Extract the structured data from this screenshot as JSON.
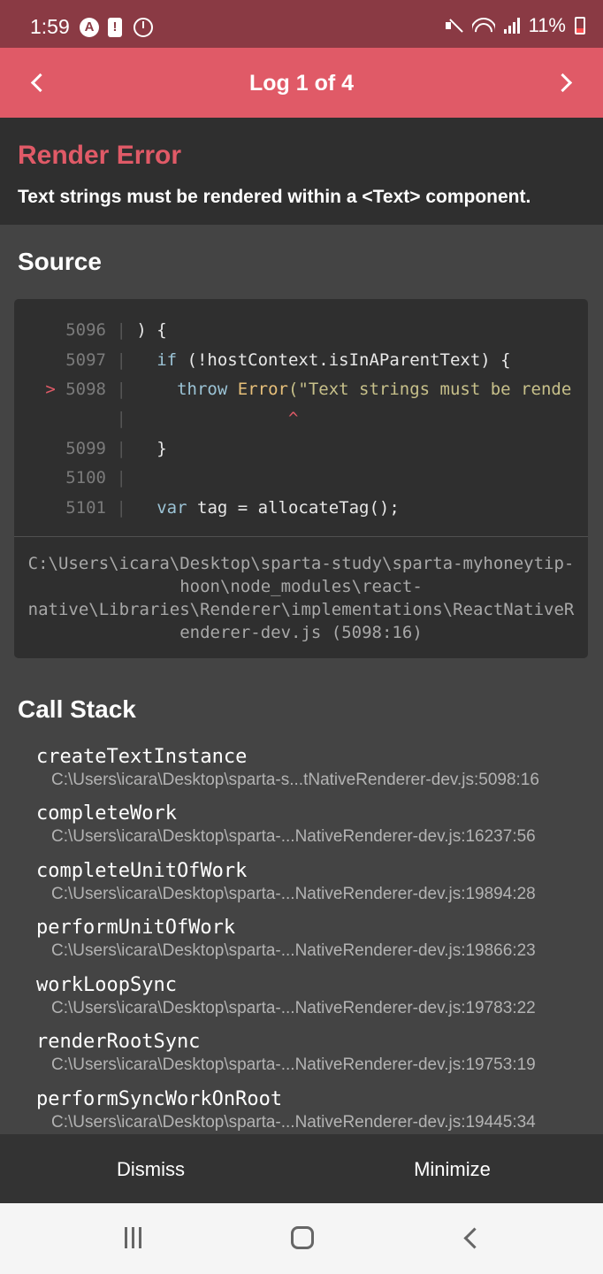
{
  "status_bar": {
    "time": "1:59",
    "battery": "11%",
    "a_icon_glyph": "A",
    "warn_icon_glyph": "!"
  },
  "header": {
    "title": "Log 1 of 4",
    "prev_icon": "chevron-left-icon",
    "next_icon": "chevron-right-icon"
  },
  "error": {
    "title": "Render Error",
    "message": "Text strings must be rendered within a <Text> component."
  },
  "source": {
    "title": "Source",
    "lines": [
      {
        "marker": "",
        "num": "5096",
        "sep": "|",
        "code": " ) {"
      },
      {
        "marker": "",
        "num": "5097",
        "sep": "|",
        "code_pre": "   if (!hostContext.isInAParentText) {"
      },
      {
        "marker": ">",
        "num": "5098",
        "sep": "|",
        "kw": "throw",
        "err": "Error",
        "str": "(\"Text strings must be rende"
      },
      {
        "marker": "",
        "num": "",
        "sep": "|",
        "caret": "^"
      },
      {
        "marker": "",
        "num": "5099",
        "sep": "|",
        "code": "   }"
      },
      {
        "marker": "",
        "num": "5100",
        "sep": "|",
        "code": ""
      },
      {
        "marker": "",
        "num": "5101",
        "sep": "|",
        "kw": "var",
        "code": " tag = allocateTag();"
      }
    ],
    "path_lines": [
      "C:\\Users\\icara\\Desktop\\sparta-study\\sparta-myhoneytip-",
      "hoon\\node_modules\\react-",
      "native\\Libraries\\Renderer\\implementations\\ReactNativeR",
      "enderer-dev.js (5098:16)"
    ]
  },
  "call_stack": {
    "title": "Call Stack",
    "frames": [
      {
        "fn": "createTextInstance",
        "loc": "C:\\Users\\icara\\Desktop\\sparta-s...tNativeRenderer-dev.js:5098:16"
      },
      {
        "fn": "completeWork",
        "loc": "C:\\Users\\icara\\Desktop\\sparta-...NativeRenderer-dev.js:16237:56"
      },
      {
        "fn": "completeUnitOfWork",
        "loc": "C:\\Users\\icara\\Desktop\\sparta-...NativeRenderer-dev.js:19894:28"
      },
      {
        "fn": "performUnitOfWork",
        "loc": "C:\\Users\\icara\\Desktop\\sparta-...NativeRenderer-dev.js:19866:23"
      },
      {
        "fn": "workLoopSync",
        "loc": "C:\\Users\\icara\\Desktop\\sparta-...NativeRenderer-dev.js:19783:22"
      },
      {
        "fn": "renderRootSync",
        "loc": "C:\\Users\\icara\\Desktop\\sparta-...NativeRenderer-dev.js:19753:19"
      },
      {
        "fn": "performSyncWorkOnRoot",
        "loc": "C:\\Users\\icara\\Desktop\\sparta-...NativeRenderer-dev.js:19445:34"
      }
    ]
  },
  "footer": {
    "dismiss": "Dismiss",
    "minimize": "Minimize"
  },
  "colors": {
    "accent": "#e05a67",
    "status_bar": "#8a3a44",
    "panel": "#2f2f2f",
    "background": "#444444"
  }
}
